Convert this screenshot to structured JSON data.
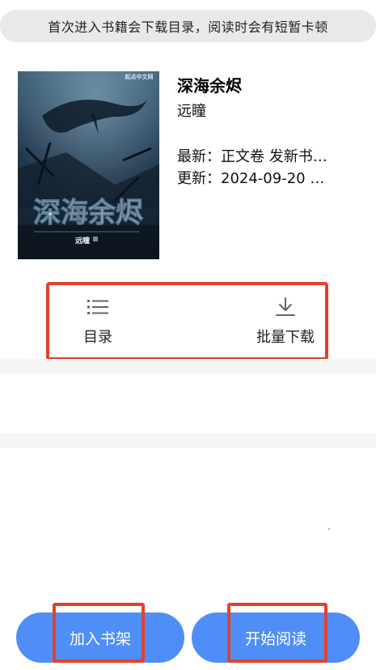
{
  "notice": {
    "text": "首次进入书籍会下载目录，阅读时会有短暂卡顿"
  },
  "book": {
    "title": "深海余烬",
    "author": "远瞳",
    "latest": "最新：正文卷 发新书…",
    "updated": "更新：2024-09-20 …"
  },
  "cover": {
    "title_art": "深海余烬",
    "publisher": "起点中文网",
    "author_stamp": "远瞳"
  },
  "actions": {
    "toc_label": "目录",
    "toc_icon": "list-icon",
    "download_label": "批量下载",
    "download_icon": "download-icon"
  },
  "bottom": {
    "add_shelf_label": "加入书架",
    "start_read_label": "开始阅读"
  },
  "colors": {
    "accent": "#4f8ef7",
    "highlight": "#e2412b",
    "notice_bg": "#e9e9e9"
  }
}
